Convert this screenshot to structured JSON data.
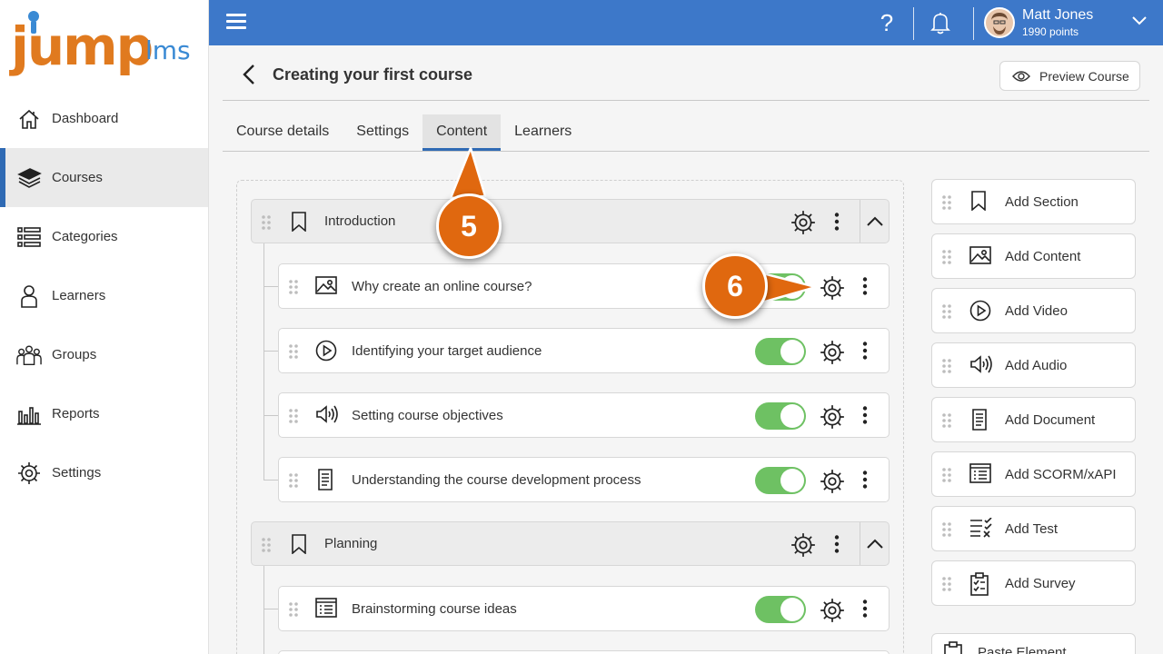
{
  "logo": {
    "jump": "jump",
    "lms": "lms"
  },
  "sidebar": {
    "items": [
      {
        "label": "Dashboard",
        "icon": "home-icon"
      },
      {
        "label": "Courses",
        "icon": "courses-icon",
        "active": true
      },
      {
        "label": "Categories",
        "icon": "categories-icon"
      },
      {
        "label": "Learners",
        "icon": "learner-icon"
      },
      {
        "label": "Groups",
        "icon": "groups-icon"
      },
      {
        "label": "Reports",
        "icon": "reports-icon"
      },
      {
        "label": "Settings",
        "icon": "gear-icon"
      }
    ]
  },
  "topbar": {
    "help_glyph": "?",
    "user_name": "Matt Jones",
    "user_points": "1990 points",
    "color": "#3d78c9"
  },
  "header": {
    "title": "Creating your first course",
    "preview_label": "Preview Course"
  },
  "tabs": [
    {
      "label": "Course details"
    },
    {
      "label": "Settings"
    },
    {
      "label": "Content",
      "active": true
    },
    {
      "label": "Learners"
    }
  ],
  "content": {
    "sections": [
      {
        "title": "Introduction",
        "items": [
          {
            "title": "Why create an online course?",
            "icon": "image-icon",
            "enabled": true
          },
          {
            "title": "Identifying your target audience",
            "icon": "video-icon",
            "enabled": true
          },
          {
            "title": "Setting course objectives",
            "icon": "audio-icon",
            "enabled": true
          },
          {
            "title": "Understanding the course development process",
            "icon": "document-icon",
            "enabled": true
          }
        ]
      },
      {
        "title": "Planning",
        "items": [
          {
            "title": "Brainstorming course ideas",
            "icon": "scorm-icon",
            "enabled": true
          }
        ]
      }
    ]
  },
  "actions": [
    {
      "label": "Add Section",
      "icon": "bookmark-icon"
    },
    {
      "label": "Add Content",
      "icon": "image-icon"
    },
    {
      "label": "Add Video",
      "icon": "video-icon"
    },
    {
      "label": "Add Audio",
      "icon": "audio-icon"
    },
    {
      "label": "Add Document",
      "icon": "document-icon"
    },
    {
      "label": "Add SCORM/xAPI",
      "icon": "scorm-icon"
    },
    {
      "label": "Add Test",
      "icon": "test-icon"
    },
    {
      "label": "Add Survey",
      "icon": "survey-icon"
    },
    {
      "label": "Paste Element",
      "icon": "paste-icon"
    }
  ],
  "callouts": [
    {
      "number": "5"
    },
    {
      "number": "6"
    }
  ],
  "colors": {
    "accent": "#2f6ab4",
    "toggle_on": "#6ec163",
    "callout": "#e0680f"
  }
}
